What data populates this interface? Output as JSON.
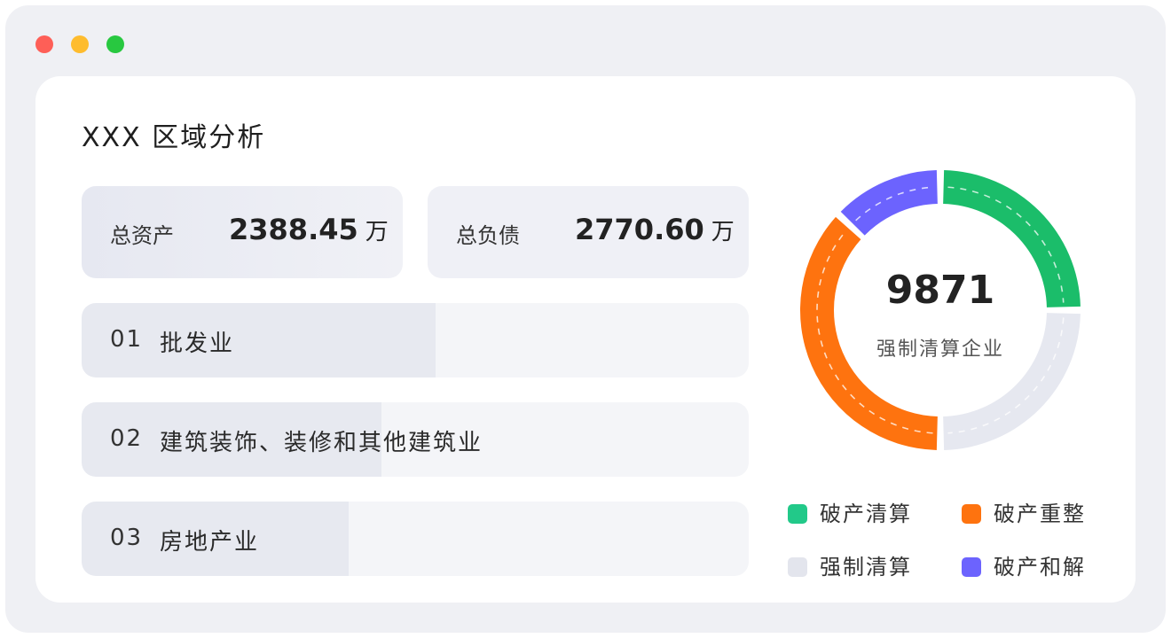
{
  "window": {
    "controls": [
      "close",
      "minimize",
      "maximize"
    ]
  },
  "title": "XXX  区域分析",
  "stats": [
    {
      "label": "总资产",
      "value": "2388.45",
      "unit": "万"
    },
    {
      "label": "总负债",
      "value": "2770.60",
      "unit": "万"
    }
  ],
  "industries": [
    {
      "num": "01",
      "name": "批发业",
      "fill": 0.53
    },
    {
      "num": "02",
      "name": "建筑装饰、装修和其他建筑业",
      "fill": 0.45
    },
    {
      "num": "03",
      "name": "房地产业",
      "fill": 0.4
    }
  ],
  "donut": {
    "total": "9871",
    "label": "强制清算企业",
    "segments": [
      {
        "name": "破产清算",
        "share": 0.25,
        "color": "#1bbd6a"
      },
      {
        "name": "强制清算",
        "share": 0.25,
        "color": "#e6e8f0"
      },
      {
        "name": "破产重整",
        "share": 0.37,
        "color": "#fe730f"
      },
      {
        "name": "破产和解",
        "share": 0.13,
        "color": "#6c63fe"
      }
    ]
  },
  "legend": [
    {
      "name": "破产清算",
      "color": "#22c989"
    },
    {
      "name": "破产重整",
      "color": "#fe730f"
    },
    {
      "name": "强制清算",
      "color": "#e3e5ed"
    },
    {
      "name": "破产和解",
      "color": "#6c63fe"
    }
  ]
}
